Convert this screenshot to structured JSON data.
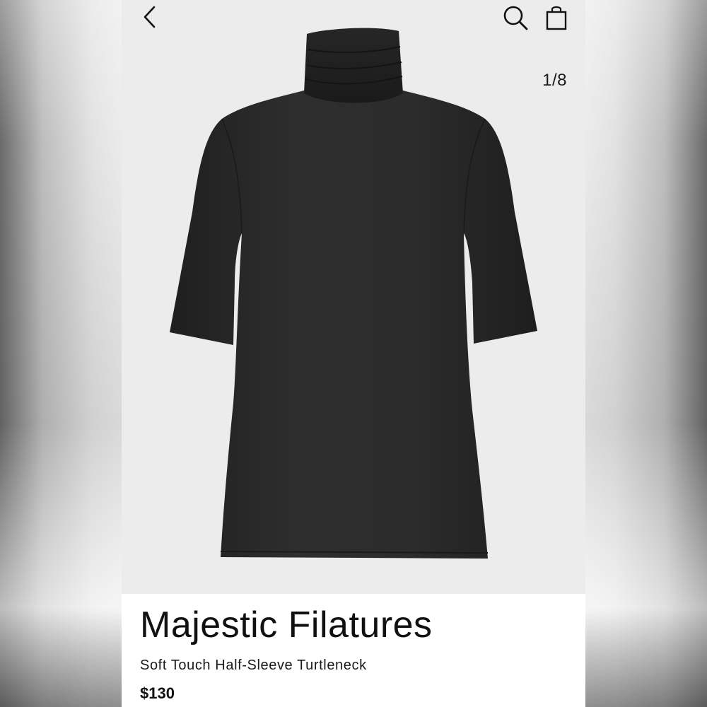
{
  "header": {
    "back_icon": "chevron-left-icon",
    "search_icon": "search-icon",
    "bag_icon": "shopping-bag-icon"
  },
  "gallery": {
    "counter": "1/8",
    "image_subject": "product-photo-turtleneck"
  },
  "product": {
    "brand": "Majestic Filatures",
    "name": "Soft Touch Half-Sleeve Turtleneck",
    "price": "$130"
  },
  "colors": {
    "image_background": "#ececec",
    "garment": "#2b2b2b",
    "text": "#111111",
    "panel": "#ffffff"
  }
}
